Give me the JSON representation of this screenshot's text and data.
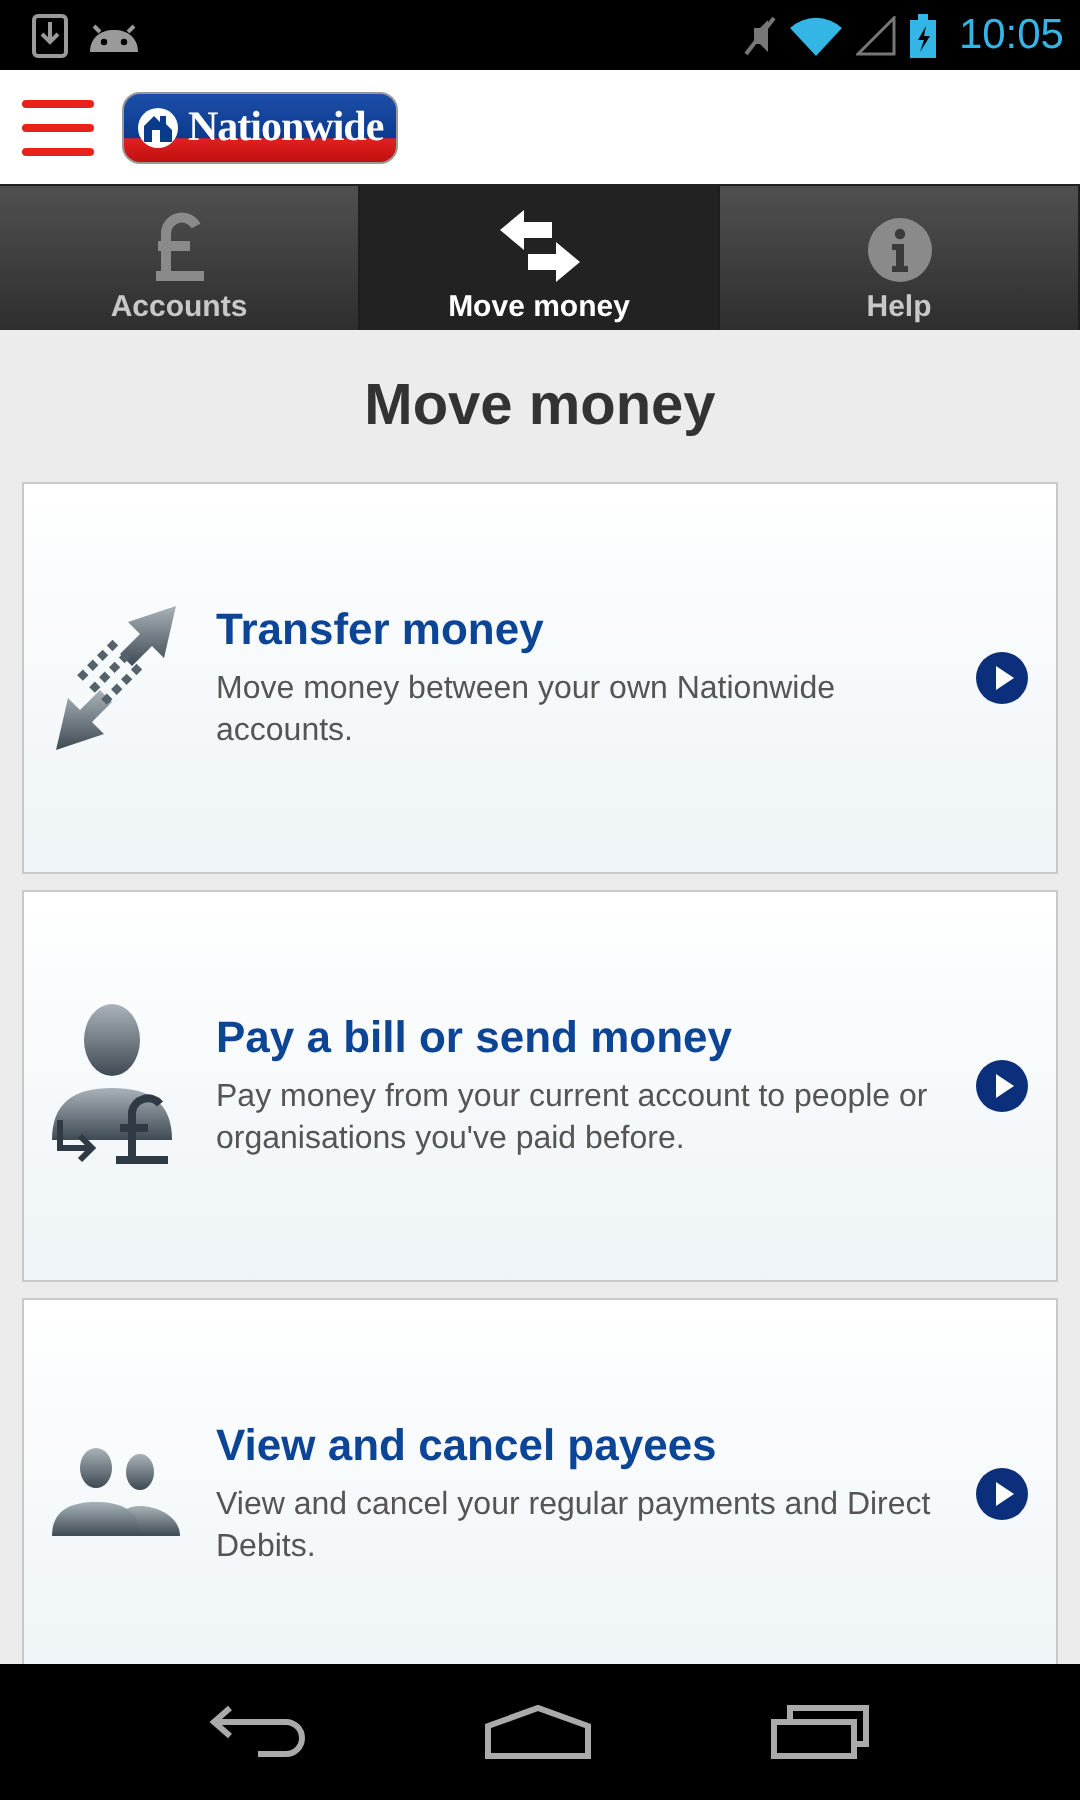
{
  "status_bar": {
    "time": "10:05"
  },
  "header": {
    "logo_text": "Nationwide"
  },
  "tabs": [
    {
      "label": "Accounts",
      "kind": "pound",
      "selected": false
    },
    {
      "label": "Move money",
      "kind": "swap",
      "selected": true
    },
    {
      "label": "Help",
      "kind": "info",
      "selected": false
    }
  ],
  "page_title": "Move money",
  "options": [
    {
      "kind": "transfer",
      "title": "Transfer money",
      "description": "Move money between your own Nationwide accounts."
    },
    {
      "kind": "payee",
      "title": "Pay a bill or send money",
      "description": "Pay money from your current account to people or organisations you've paid before."
    },
    {
      "kind": "payees",
      "title": "View and cancel payees",
      "description": "View and cancel your regular payments and Direct Debits."
    }
  ]
}
